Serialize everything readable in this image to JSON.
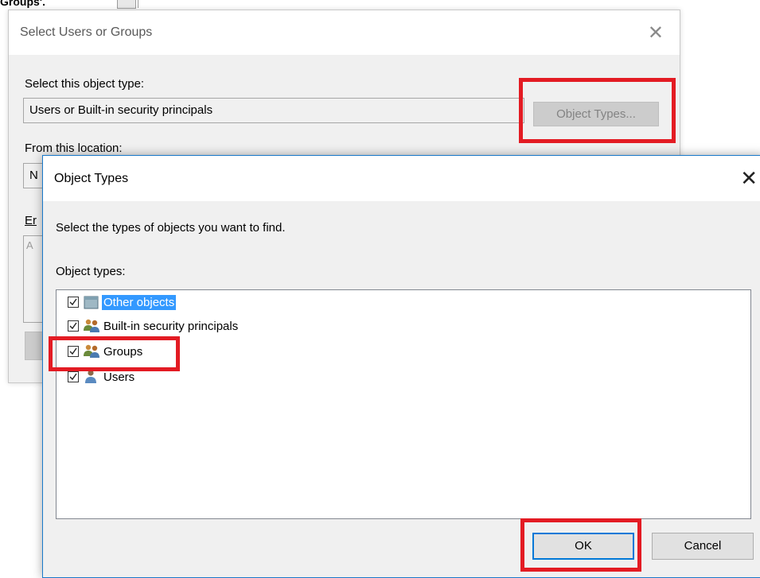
{
  "doc_caption": "Groups'.",
  "back_dialog": {
    "title": "Select Users or Groups",
    "object_type_label": "Select this object type:",
    "object_type_value": "Users or Built-in security principals",
    "object_types_button": "Object Types...",
    "location_label": "From this location:",
    "location_value_partial": "N",
    "enter_label_partial": "Er",
    "names_field_partial": "A"
  },
  "front_dialog": {
    "title": "Object Types",
    "instruction": "Select the types of objects you want to find.",
    "list_label": "Object types:",
    "items": [
      {
        "label": "Other objects",
        "checked": true,
        "selected": true,
        "icon": "folder-icon"
      },
      {
        "label": "Built-in security principals",
        "checked": true,
        "selected": false,
        "icon": "group-icon"
      },
      {
        "label": "Groups",
        "checked": true,
        "selected": false,
        "icon": "group-icon"
      },
      {
        "label": "Users",
        "checked": true,
        "selected": false,
        "icon": "user-icon"
      }
    ],
    "ok_button": "OK",
    "cancel_button": "Cancel"
  },
  "colors": {
    "highlight_box": "#e31b23",
    "selection": "#3399ff",
    "ok_focus_border": "#0078d7"
  }
}
